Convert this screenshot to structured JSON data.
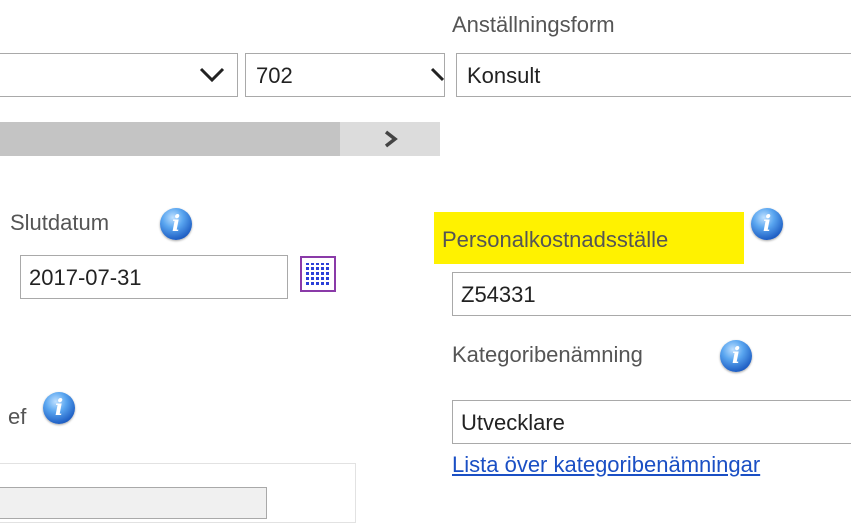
{
  "left_column": {
    "department_select": {
      "value": ""
    },
    "code_select": {
      "value": "702"
    },
    "end_date": {
      "label": "Slutdatum",
      "value": "2017-07-31"
    },
    "manager_label_fragment": "ef"
  },
  "right_column": {
    "employment_type": {
      "label": "Anställningsform",
      "value": "Konsult"
    },
    "personnel_cost_center": {
      "label": "Personalkostnadsställe",
      "value": "Z54331",
      "highlight_color": "#fff200"
    },
    "category_name": {
      "label": "Kategoribenämning",
      "value": "Utvecklare"
    },
    "category_list_link": "Lista över kategoribenämningar"
  },
  "icons": {
    "info": "i",
    "chevron_right": "›"
  },
  "colors": {
    "link": "#1a4fc4",
    "info_icon": "#1f5fc4",
    "calendar_border": "#8a3aa8",
    "scrollbar_track": "#dcdcdc"
  }
}
